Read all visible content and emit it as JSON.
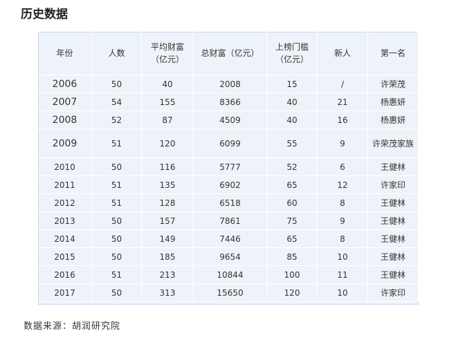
{
  "title": "历史数据",
  "table": {
    "headers": [
      "年份",
      "人数",
      "平均财富\n（亿元）",
      "总财富（亿元）",
      "上榜门槛\n（亿元）",
      "新人",
      "第一名"
    ],
    "rows": [
      [
        "2006",
        "50",
        "40",
        "2008",
        "15",
        "/",
        "许荣茂"
      ],
      [
        "2007",
        "54",
        "155",
        "8366",
        "40",
        "21",
        "杨惠妍"
      ],
      [
        "2008",
        "52",
        "87",
        "4509",
        "40",
        "16",
        "杨惠妍"
      ],
      [
        "2009",
        "51",
        "120",
        "6099",
        "55",
        "9",
        "许荣茂家族"
      ],
      [
        "2010",
        "50",
        "116",
        "5777",
        "52",
        "6",
        "王健林"
      ],
      [
        "2011",
        "51",
        "135",
        "6902",
        "65",
        "12",
        "许家印"
      ],
      [
        "2012",
        "51",
        "128",
        "6518",
        "60",
        "8",
        "王健林"
      ],
      [
        "2013",
        "50",
        "157",
        "7861",
        "75",
        "9",
        "王健林"
      ],
      [
        "2014",
        "50",
        "149",
        "7446",
        "65",
        "8",
        "王健林"
      ],
      [
        "2015",
        "50",
        "185",
        "9654",
        "85",
        "10",
        "王健林"
      ],
      [
        "2016",
        "51",
        "213",
        "10844",
        "100",
        "11",
        "王健林"
      ],
      [
        "2017",
        "50",
        "313",
        "15650",
        "120",
        "10",
        "许家印"
      ]
    ]
  },
  "source_note": "数据来源：胡润研究院"
}
